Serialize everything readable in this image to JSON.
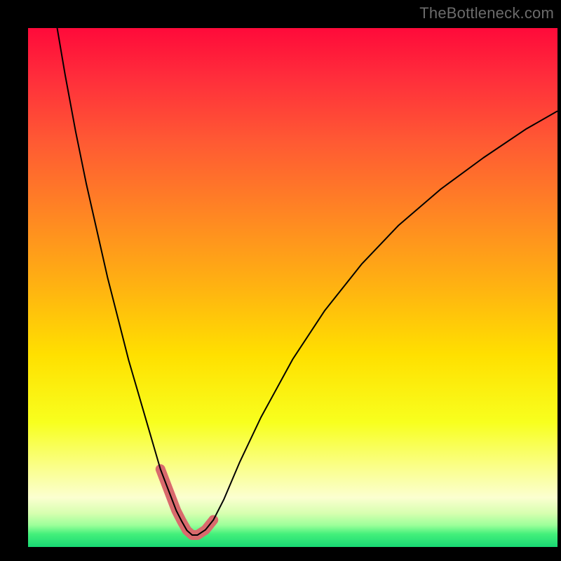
{
  "watermark": {
    "text": "TheBottleneck.com"
  },
  "gradient": {
    "stops": [
      {
        "offset": 0.0,
        "color": "#ff0a3a"
      },
      {
        "offset": 0.1,
        "color": "#ff2f3b"
      },
      {
        "offset": 0.22,
        "color": "#ff5a33"
      },
      {
        "offset": 0.35,
        "color": "#ff8324"
      },
      {
        "offset": 0.5,
        "color": "#ffb311"
      },
      {
        "offset": 0.63,
        "color": "#ffe000"
      },
      {
        "offset": 0.76,
        "color": "#f8ff1e"
      },
      {
        "offset": 0.85,
        "color": "#faff8f"
      },
      {
        "offset": 0.905,
        "color": "#fbffd0"
      },
      {
        "offset": 0.935,
        "color": "#d7ffb0"
      },
      {
        "offset": 0.958,
        "color": "#9cff9a"
      },
      {
        "offset": 0.975,
        "color": "#44f07b"
      },
      {
        "offset": 1.0,
        "color": "#18d873"
      }
    ]
  },
  "chart_data": {
    "type": "line",
    "title": "",
    "xlabel": "",
    "ylabel": "",
    "xlim": [
      0,
      100
    ],
    "ylim": [
      0,
      100
    ],
    "grid": false,
    "series": [
      {
        "name": "curve",
        "stroke": "#000000",
        "stroke_width": 2,
        "x": [
          5.5,
          7,
          9,
          11,
          13,
          15,
          17,
          19,
          21,
          23,
          25,
          26.5,
          28,
          29,
          30,
          31,
          32,
          33.5,
          35,
          37,
          40,
          44,
          50,
          56,
          63,
          70,
          78,
          86,
          94,
          100
        ],
        "y": [
          100,
          91,
          80,
          70,
          61,
          52,
          44,
          36,
          29,
          22,
          15,
          11,
          7,
          5,
          3.2,
          2.3,
          2.3,
          3.3,
          5.2,
          9.2,
          16.4,
          25,
          36.2,
          45.5,
          54.5,
          62,
          69,
          75,
          80.5,
          84
        ]
      },
      {
        "name": "highlight-marker",
        "stroke": "#d96a6d",
        "stroke_width": 14,
        "linecap": "round",
        "x": [
          25,
          26.5,
          28,
          29,
          30,
          31,
          32,
          33.5,
          35
        ],
        "y": [
          15,
          11,
          7,
          5,
          3.2,
          2.3,
          2.3,
          3.3,
          5.2
        ]
      }
    ]
  }
}
